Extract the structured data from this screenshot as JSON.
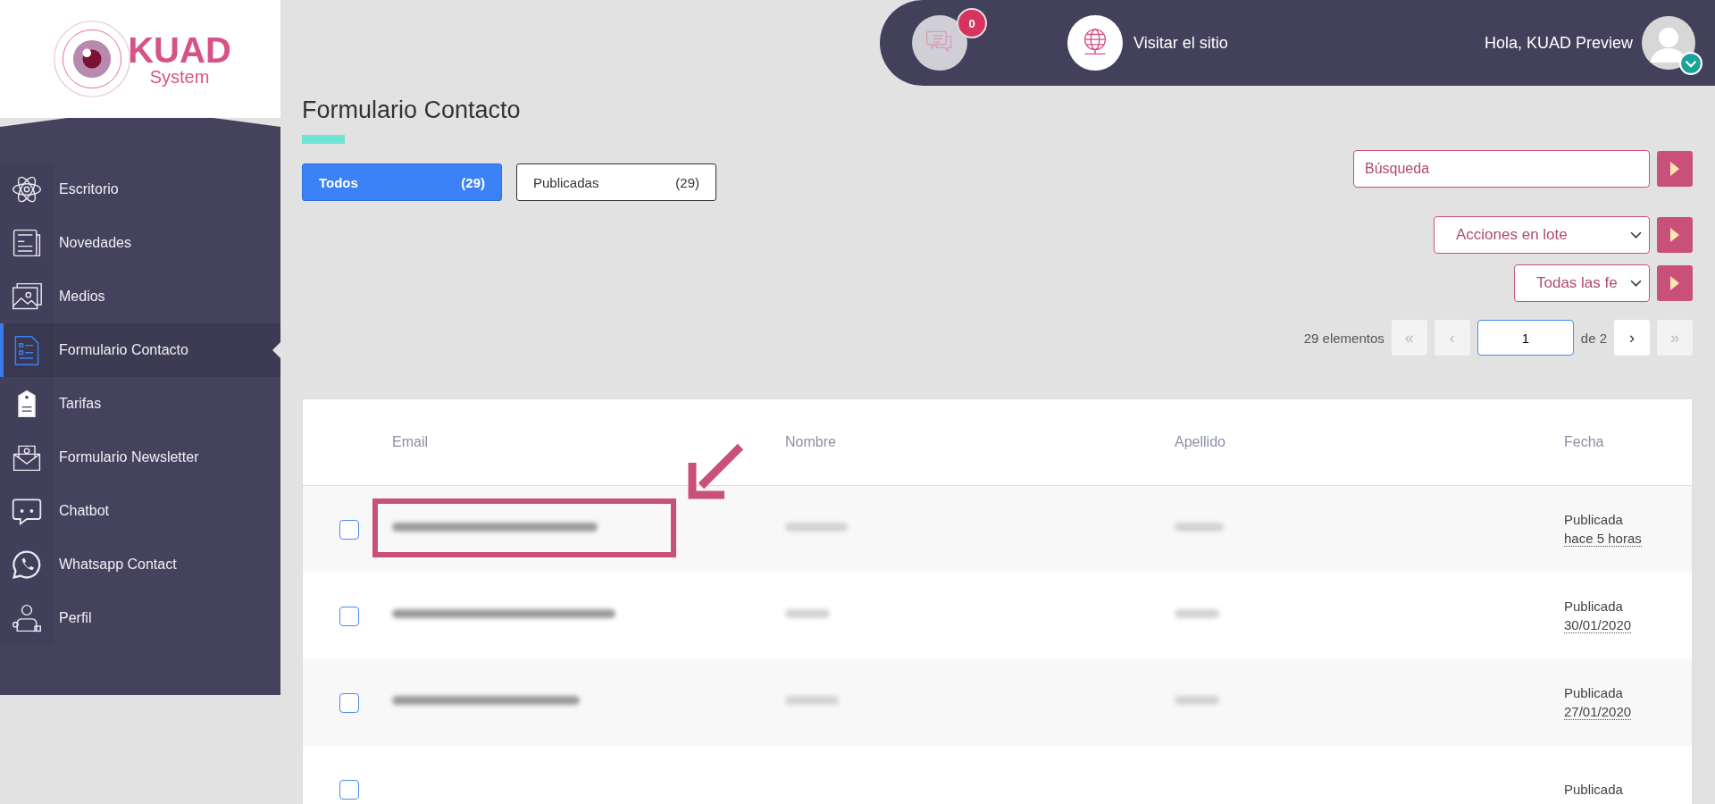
{
  "logo": {
    "title": "KUAD",
    "subtitle": "System"
  },
  "sidebar": {
    "items": [
      {
        "label": "Escritorio",
        "kind": "atom",
        "selected": false
      },
      {
        "label": "Novedades",
        "kind": "news",
        "selected": false
      },
      {
        "label": "Medios",
        "kind": "image",
        "selected": false
      },
      {
        "label": "Formulario Contacto",
        "kind": "form",
        "selected": true
      },
      {
        "label": "Tarifas",
        "kind": "tag",
        "selected": false
      },
      {
        "label": "Formulario Newsletter",
        "kind": "mail",
        "selected": false
      },
      {
        "label": "Chatbot",
        "kind": "chat",
        "selected": false
      },
      {
        "label": "Whatsapp Contact",
        "kind": "whatsapp",
        "selected": false
      },
      {
        "label": "Perfil",
        "kind": "user",
        "selected": false
      }
    ]
  },
  "topbar": {
    "messages_count": "0",
    "visit_site": "Visitar el sitio",
    "greeting": "Hola, KUAD Preview"
  },
  "page": {
    "title": "Formulario Contacto"
  },
  "tabs": [
    {
      "label": "Todos",
      "count": "(29)",
      "selected": true
    },
    {
      "label": "Publicadas",
      "count": "(29)",
      "selected": false
    }
  ],
  "search": {
    "placeholder": "Búsqueda"
  },
  "bulk_actions": {
    "value": "Acciones en lote"
  },
  "date_filter": {
    "value": "Todas las fe"
  },
  "pagination": {
    "total": "29 elementos",
    "first": "«",
    "prev": "‹",
    "page": "1",
    "of": "de 2",
    "next": "›",
    "last": "»"
  },
  "table": {
    "columns": [
      "Email",
      "Nombre",
      "Apellido",
      "Fecha"
    ],
    "rows": [
      {
        "checked": false,
        "status": "Publicada",
        "date": "hace 5 horas",
        "highlighted": true
      },
      {
        "checked": false,
        "status": "Publicada",
        "date": "30/01/2020",
        "highlighted": false
      },
      {
        "checked": false,
        "status": "Publicada",
        "date": "27/01/2020",
        "highlighted": false
      },
      {
        "checked": false,
        "status": "Publicada",
        "highlighted": false
      }
    ]
  }
}
